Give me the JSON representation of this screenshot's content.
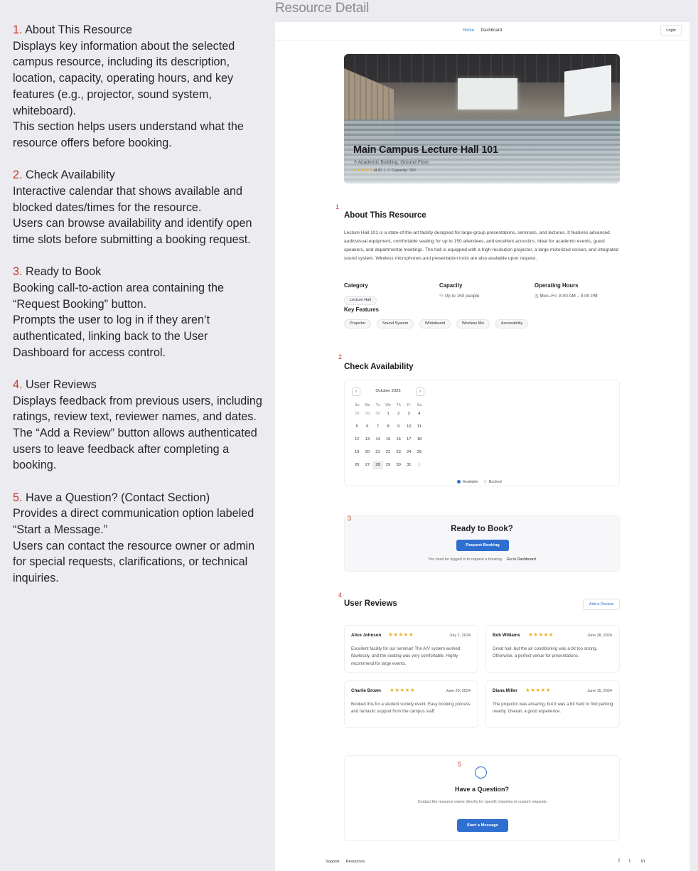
{
  "page_heading": "Resource Detail",
  "notes": [
    {
      "num": "1.",
      "title": "About This Resource",
      "lines": [
        "Displays key information about the selected campus resource, including its description, location, capacity, operating hours, and key features (e.g., projector, sound system, whiteboard).",
        "This section helps users understand what the resource offers before booking."
      ]
    },
    {
      "num": "2.",
      "title": "Check Availability",
      "lines": [
        "Interactive calendar that shows available and blocked dates/times for the resource.",
        "Users can browse availability and identify open time slots before submitting a booking request."
      ]
    },
    {
      "num": "3.",
      "title": "Ready to Book",
      "lines": [
        "Booking call-to-action area containing the “Request Booking” button.",
        "Prompts the user to log in if they aren’t authenticated, linking back to the User Dashboard for access control."
      ]
    },
    {
      "num": "4.",
      "title": "User Reviews",
      "lines": [
        "Displays feedback from previous users, including ratings, review text, reviewer names, and dates.",
        "The “Add a Review” button allows authenticated users to leave feedback after completing a booking."
      ]
    },
    {
      "num": "5.",
      "title": "Have a Question? (Contact Section)",
      "lines": [
        "Provides a direct communication option labeled “Start a Message.”",
        "Users can contact the resource owner or admin for special requests, clarifications, or technical inquiries."
      ]
    }
  ],
  "nav": {
    "home": "Home",
    "dashboard": "Dashboard",
    "login": "Login"
  },
  "hero": {
    "title": "Main Campus Lecture Hall 101",
    "location": "Academic Building, Ground Floor",
    "stars": "★★★★★",
    "rating": "(4.8)",
    "capacity": "Capacity: 150"
  },
  "markers": [
    "1",
    "2",
    "3",
    "4",
    "5"
  ],
  "about": {
    "title": "About This Resource",
    "text": "Lecture Hall 101 is a state-of-the-art facility designed for large-group presentations, seminars, and lectures. It features advanced audiovisual equipment, comfortable seating for up to 150 attendees, and excellent acoustics. Ideal for academic events, guest speakers, and departmental meetings. The hall is equipped with a high-resolution projector, a large motorized screen, and integrated sound system. Wireless microphones and presentation tools are also available upon request.",
    "category_label": "Category",
    "category": "Lecture Hall",
    "capacity_label": "Capacity",
    "capacity": "Up to 150 people",
    "hours_label": "Operating Hours",
    "hours": "Mon–Fri: 8:00 AM – 9:00 PM",
    "features_label": "Key Features",
    "features": [
      "Projector",
      "Sound System",
      "Whiteboard",
      "Wireless Mic",
      "Accessibility"
    ]
  },
  "availability": {
    "title": "Check Availability",
    "month": "October 2025",
    "prev": "‹",
    "next": "›",
    "dow": [
      "Su",
      "Mo",
      "Tu",
      "We",
      "Th",
      "Fr",
      "Sa"
    ],
    "weeks": [
      [
        "28",
        "29",
        "30",
        "1",
        "2",
        "3",
        "4"
      ],
      [
        "5",
        "6",
        "7",
        "8",
        "9",
        "10",
        "11"
      ],
      [
        "12",
        "13",
        "14",
        "15",
        "16",
        "17",
        "18"
      ],
      [
        "19",
        "20",
        "21",
        "22",
        "23",
        "24",
        "25"
      ],
      [
        "26",
        "27",
        "28",
        "29",
        "30",
        "31",
        "1"
      ]
    ],
    "today": "28",
    "legend_available": "Available",
    "legend_booked": "Booked",
    "available_color": "#2f6fd0",
    "booked_color": "#e6e6ea"
  },
  "booking": {
    "title": "Ready to Book?",
    "button": "Request Booking",
    "note": "You must be logged in to request a booking.",
    "dashboard_link": "Go to Dashboard"
  },
  "reviews": {
    "title": "User Reviews",
    "add_button": "Add a Review",
    "items": [
      {
        "name": "Alice Johnson",
        "stars": "★★★★★",
        "date": "July 1, 2024",
        "text": "Excellent facility for our seminar! The A/V system worked flawlessly, and the seating was very comfortable. Highly recommend for large events."
      },
      {
        "name": "Bob Williams",
        "stars": "★★★★★",
        "date": "June 28, 2024",
        "text": "Great hall, but the air conditioning was a bit too strong. Otherwise, a perfect venue for presentations."
      },
      {
        "name": "Charlie Brown",
        "stars": "★★★★★",
        "date": "June 20, 2024",
        "text": "Booked this for a student society event. Easy booking process and fantastic support from the campus staff."
      },
      {
        "name": "Diana Miller",
        "stars": "★★★★★",
        "date": "June 15, 2024",
        "text": "The projector was amazing, but it was a bit hard to find parking nearby. Overall, a good experience."
      }
    ]
  },
  "question": {
    "title": "Have a Question?",
    "text": "Contact the resource owner directly for specific inquiries or custom requests.",
    "button": "Start a Message"
  },
  "footer": {
    "support": "Support",
    "resources": "Resources"
  },
  "social": {
    "facebook": "f",
    "twitter": "t",
    "linkedin": "in"
  },
  "colors": {
    "accent": "#2f6fd0",
    "marker": "#c0392b",
    "star": "#e6b325"
  }
}
